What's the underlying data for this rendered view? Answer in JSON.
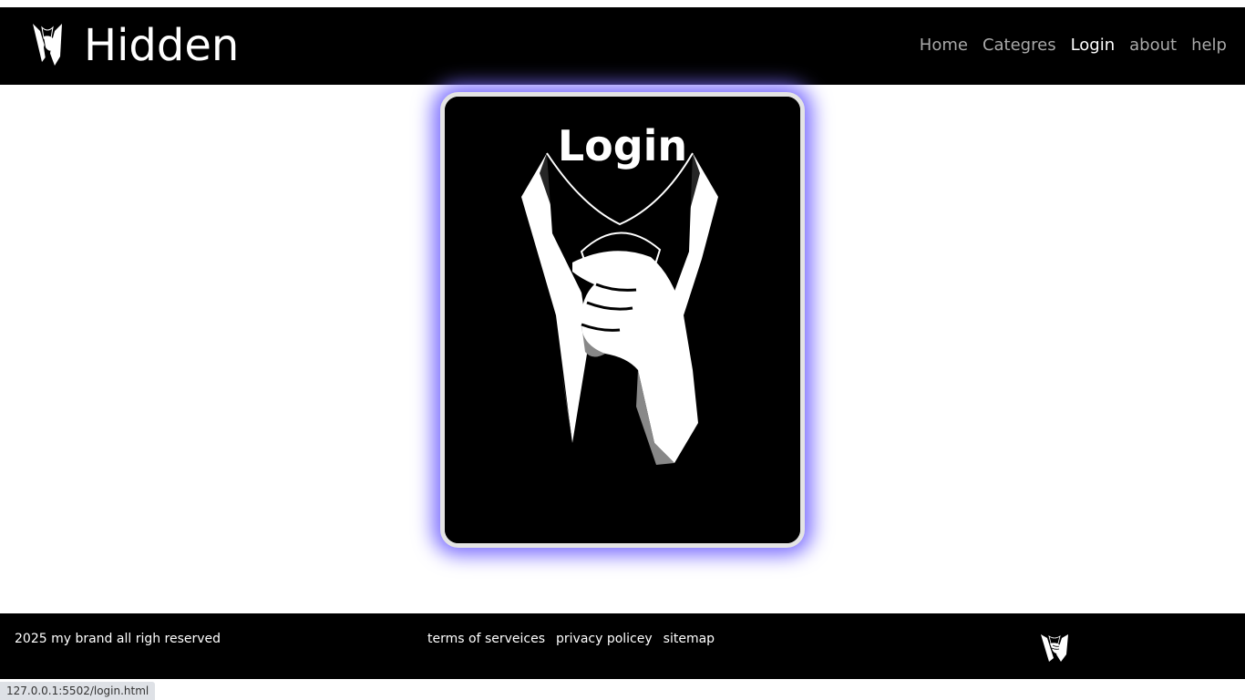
{
  "header": {
    "brand_name": "Hidden",
    "brand_logo_icon": "suit-tie-icon",
    "nav": [
      {
        "label": "Home",
        "active": false
      },
      {
        "label": "Categres",
        "active": false
      },
      {
        "label": "Login",
        "active": true
      },
      {
        "label": "about",
        "active": false
      },
      {
        "label": "help",
        "active": false
      }
    ]
  },
  "main": {
    "card": {
      "title": "Login",
      "image_icon": "suit-tie-illustration",
      "glow_color": "#7a6cff"
    }
  },
  "footer": {
    "copyright": "2025 my brand all righ reserved",
    "links": [
      {
        "label": "terms of serveices"
      },
      {
        "label": "privacy policey"
      },
      {
        "label": "sitemap"
      }
    ],
    "logo_icon": "suit-tie-icon"
  },
  "status_bar": {
    "url": "127.0.0.1:5502/login.html"
  },
  "colors": {
    "header_bg": "#000000",
    "footer_bg": "#000000",
    "nav_inactive": "#a9a9a9",
    "nav_active": "#ffffff",
    "card_border": "#e4e4e4"
  }
}
